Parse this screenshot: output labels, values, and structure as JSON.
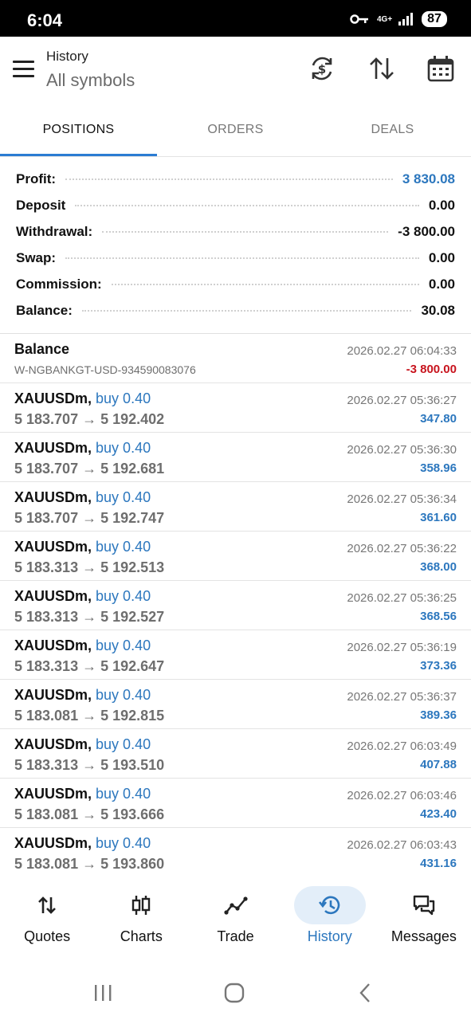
{
  "status_bar": {
    "time": "6:04",
    "network": "4G+",
    "battery": "87"
  },
  "header": {
    "title": "History",
    "subtitle": "All symbols"
  },
  "tabs": [
    {
      "label": "POSITIONS",
      "active": true
    },
    {
      "label": "ORDERS",
      "active": false
    },
    {
      "label": "DEALS",
      "active": false
    }
  ],
  "summary": {
    "profit_label": "Profit:",
    "profit_value": "3 830.08",
    "deposit_label": "Deposit",
    "deposit_value": "0.00",
    "withdrawal_label": "Withdrawal:",
    "withdrawal_value": "-3 800.00",
    "swap_label": "Swap:",
    "swap_value": "0.00",
    "commission_label": "Commission:",
    "commission_value": "0.00",
    "balance_label": "Balance:",
    "balance_value": "30.08"
  },
  "balance_entry": {
    "title": "Balance",
    "reference": "W-NGBANKGT-USD-934590083076",
    "time": "2026.02.27 06:04:33",
    "amount": "-3 800.00"
  },
  "positions": [
    {
      "symbol": "XAUUSDm,",
      "side": "buy 0.40",
      "prices": "5 183.707 → 5 192.402",
      "time": "2026.02.27 05:36:27",
      "profit": "347.80"
    },
    {
      "symbol": "XAUUSDm,",
      "side": "buy 0.40",
      "prices": "5 183.707 → 5 192.681",
      "time": "2026.02.27 05:36:30",
      "profit": "358.96"
    },
    {
      "symbol": "XAUUSDm,",
      "side": "buy 0.40",
      "prices": "5 183.707 → 5 192.747",
      "time": "2026.02.27 05:36:34",
      "profit": "361.60"
    },
    {
      "symbol": "XAUUSDm,",
      "side": "buy 0.40",
      "prices": "5 183.313 → 5 192.513",
      "time": "2026.02.27 05:36:22",
      "profit": "368.00"
    },
    {
      "symbol": "XAUUSDm,",
      "side": "buy 0.40",
      "prices": "5 183.313 → 5 192.527",
      "time": "2026.02.27 05:36:25",
      "profit": "368.56"
    },
    {
      "symbol": "XAUUSDm,",
      "side": "buy 0.40",
      "prices": "5 183.313 → 5 192.647",
      "time": "2026.02.27 05:36:19",
      "profit": "373.36"
    },
    {
      "symbol": "XAUUSDm,",
      "side": "buy 0.40",
      "prices": "5 183.081 → 5 192.815",
      "time": "2026.02.27 05:36:37",
      "profit": "389.36"
    },
    {
      "symbol": "XAUUSDm,",
      "side": "buy 0.40",
      "prices": "5 183.313 → 5 193.510",
      "time": "2026.02.27 06:03:49",
      "profit": "407.88"
    },
    {
      "symbol": "XAUUSDm,",
      "side": "buy 0.40",
      "prices": "5 183.081 → 5 193.666",
      "time": "2026.02.27 06:03:46",
      "profit": "423.40"
    },
    {
      "symbol": "XAUUSDm,",
      "side": "buy 0.40",
      "prices": "5 183.081 → 5 193.860",
      "time": "2026.02.27 06:03:43",
      "profit": "431.16"
    }
  ],
  "bottom_nav": [
    {
      "label": "Quotes",
      "icon": "quotes-icon",
      "active": false
    },
    {
      "label": "Charts",
      "icon": "charts-icon",
      "active": false
    },
    {
      "label": "Trade",
      "icon": "trade-icon",
      "active": false
    },
    {
      "label": "History",
      "icon": "history-icon",
      "active": true
    },
    {
      "label": "Messages",
      "icon": "messages-icon",
      "active": false
    }
  ],
  "colors": {
    "accent": "#2c77be",
    "negative": "#c8141e",
    "tab_indicator": "#2b7cd3"
  }
}
